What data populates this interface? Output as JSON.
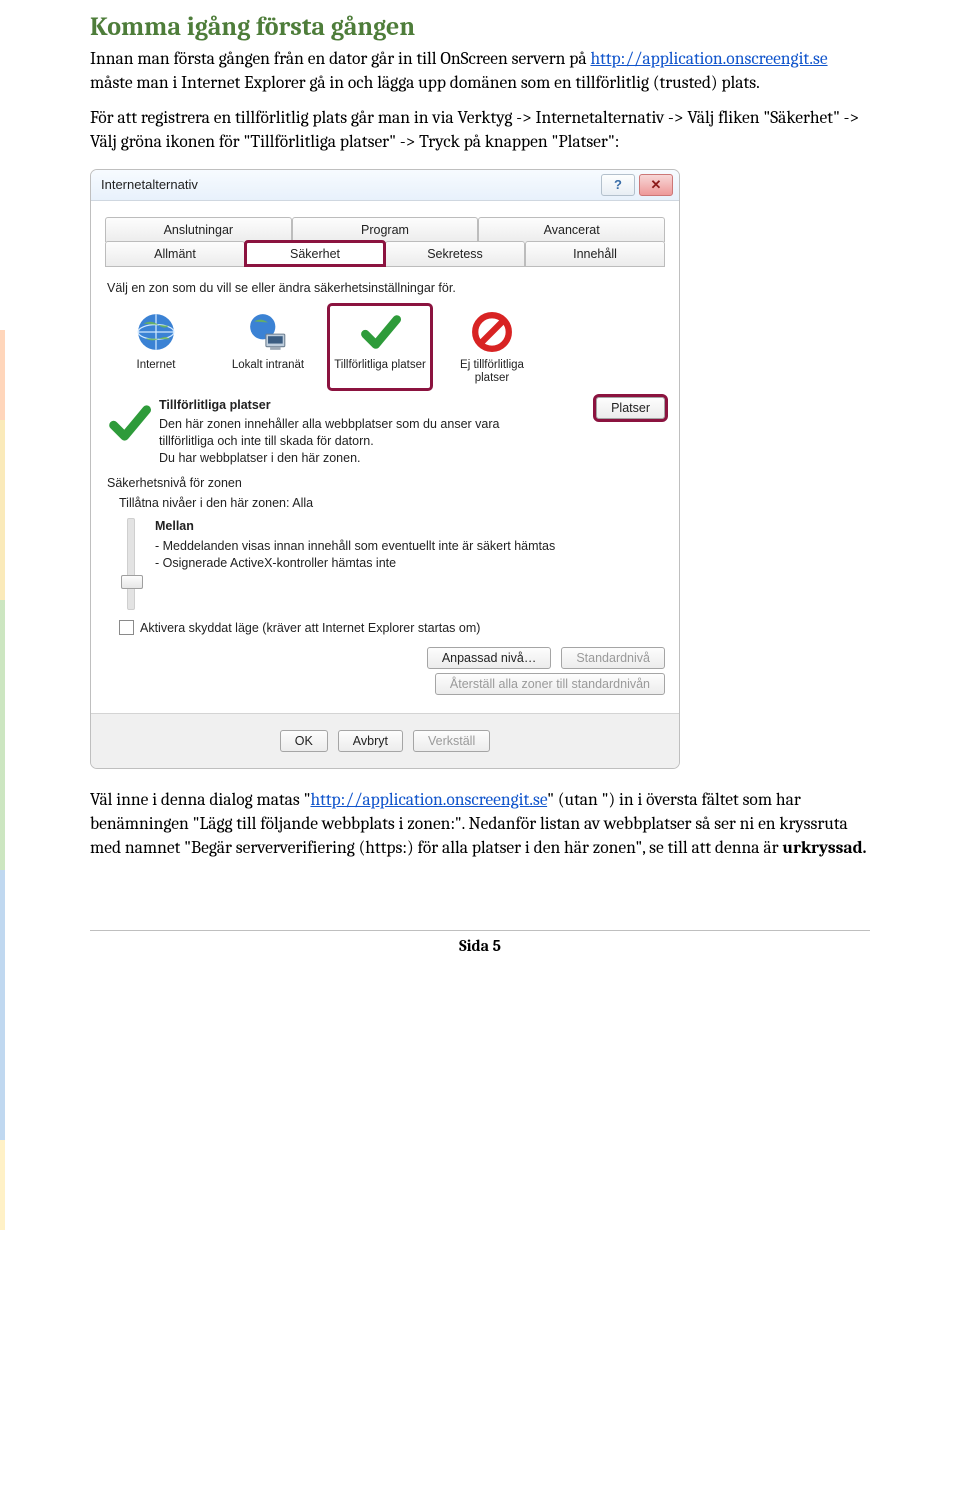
{
  "doc": {
    "heading": "Komma igång första gången",
    "p1a": "Innan man första gången från en dator går in till OnScreen servern på ",
    "p1link": "http://application.onscreengit.se",
    "p1b": " måste man i Internet Explorer gå in och lägga upp domänen som en tillförlitlig (trusted) plats.",
    "p2": "För att registrera en tillförlitlig plats går man in via Verktyg -> Internetalternativ -> Välj fliken \"Säkerhet\" -> Välj gröna ikonen för \"Tillförlitliga platser\" -> Tryck på knappen \"Platser\":",
    "p3a": "Väl inne i denna dialog matas \"",
    "p3link": "http://application.onscreengit.se",
    "p3b": "\" (utan \") in i översta fältet som har benämningen \"Lägg till följande webbplats i zonen:\". Nedanför listan av webbplatser så ser ni en kryssruta med namnet \"Begär serververifiering (https:) för alla platser i den här zonen\", se till att denna är ",
    "p3bold": "urkryssad.",
    "footer": "Sida 5"
  },
  "dialog": {
    "title": "Internetalternativ",
    "tabs_top": [
      "Anslutningar",
      "Program",
      "Avancerat"
    ],
    "tabs_bottom": [
      "Allmänt",
      "Säkerhet",
      "Sekretess",
      "Innehåll"
    ],
    "zone_instr": "Välj en zon som du vill se eller ändra säkerhetsinställningar för.",
    "zones": [
      "Internet",
      "Lokalt intranät",
      "Tillförlitliga platser",
      "Ej tillförlitliga platser"
    ],
    "zone_desc_title": "Tillförlitliga platser",
    "zone_desc_lines": [
      "Den här zonen innehåller alla webbplatser som du anser vara tillförlitliga och inte till skada för datorn.",
      "Du har webbplatser i den här zonen."
    ],
    "platser_btn": "Platser",
    "sec_heading": "Säkerhetsnivå för zonen",
    "allowed_levels": "Tillåtna nivåer i den här zonen: Alla",
    "level_name": "Mellan",
    "level_bullets": [
      "- Meddelanden visas innan innehåll som eventuellt inte är säkert hämtas",
      "- Osignerade ActiveX-kontroller hämtas inte"
    ],
    "protected_mode": "Aktivera skyddat läge (kräver att Internet Explorer startas om)",
    "custom_btn": "Anpassad nivå…",
    "default_btn": "Standardnivå",
    "reset_btn": "Återställ alla zoner till standardnivån",
    "ok": "OK",
    "cancel": "Avbryt",
    "apply": "Verkställ"
  }
}
